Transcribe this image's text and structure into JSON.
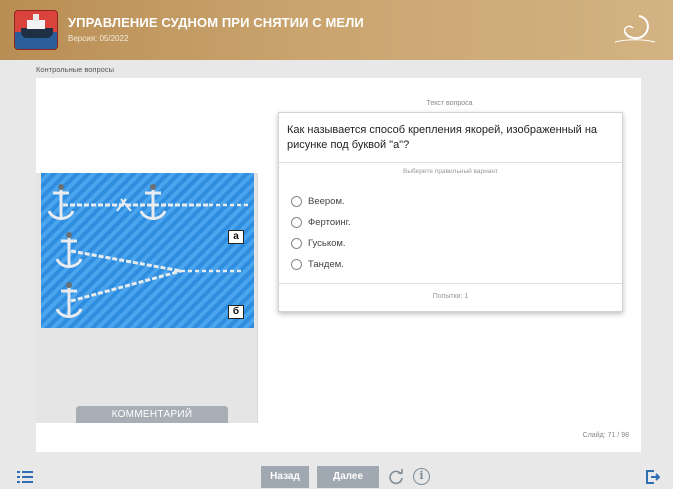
{
  "header": {
    "title": "УПРАВЛЕНИЕ СУДНОМ ПРИ СНЯТИИ С МЕЛИ",
    "version": "Версия: 05/2022",
    "logo_icon": "ship-icon",
    "brand_icon": "brand-logo-icon"
  },
  "section": {
    "label": "Контрольные вопросы"
  },
  "image": {
    "tag_a": "а",
    "tag_b": "б"
  },
  "comment": {
    "label": "КОММЕНТАРИЙ"
  },
  "question": {
    "type_label": "Текст вопроса",
    "text": "Как называется способ крепления якорей, изображенный на рисунке под буквой \"а\"?",
    "hint": "Выберите правильный вариант",
    "options": [
      "Веером.",
      "Фертоинг.",
      "Гуськом.",
      "Тандем."
    ],
    "attempts": "Попытки: 1"
  },
  "slide_counter": "Слайд: 71 / 98",
  "footer": {
    "back_label": "Назад",
    "next_label": "Далее",
    "info_label": "i"
  },
  "colors": {
    "header_bg": "#c9a46e",
    "button_bg": "#a0a8b1",
    "image_blue": "#2f8de0"
  }
}
